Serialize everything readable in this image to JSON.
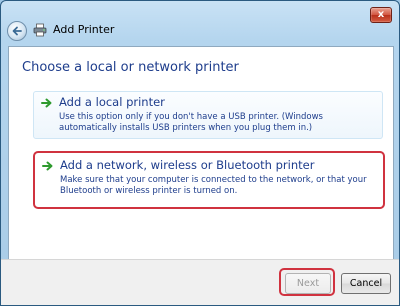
{
  "window": {
    "title": "Add Printer",
    "close_glyph": "x"
  },
  "icons": {
    "back": "back-arrow-icon",
    "printer": "printer-icon",
    "option_arrow": "green-arrow-icon"
  },
  "content": {
    "heading": "Choose a local or network printer",
    "options": [
      {
        "title": "Add a local printer",
        "description": "Use this option only if you don't have a USB printer. (Windows automatically installs USB printers when you plug them in.)"
      },
      {
        "title": "Add a network, wireless or Bluetooth printer",
        "description": "Make sure that your computer is connected to the network, or that your Bluetooth or wireless printer is turned on."
      }
    ]
  },
  "footer": {
    "next_label": "Next",
    "cancel_label": "Cancel"
  },
  "colors": {
    "accent_text": "#1e3d8c",
    "highlight_border": "#d0323f",
    "arrow_green": "#2e9a2e"
  }
}
